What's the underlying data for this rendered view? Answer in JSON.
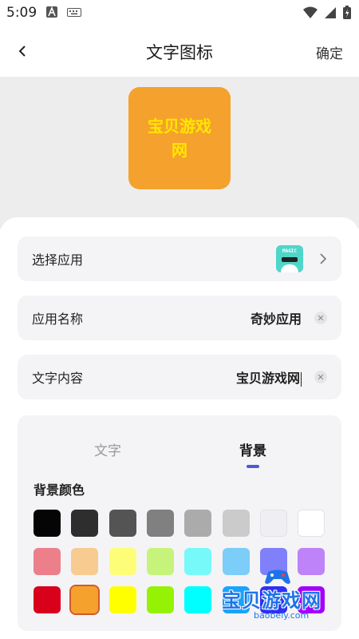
{
  "status_bar": {
    "time": "5:09"
  },
  "app_bar": {
    "title": "文字图标",
    "confirm_label": "确定"
  },
  "preview": {
    "icon_text": "宝贝游戏网",
    "bg_color": "#f5a12d",
    "text_color": "#ffe600"
  },
  "rows": {
    "select_app": {
      "label": "选择应用",
      "app_icon_text": "MAGIC"
    },
    "app_name": {
      "label": "应用名称",
      "value": "奇妙应用"
    },
    "text_content": {
      "label": "文字内容",
      "value": "宝贝游戏网"
    }
  },
  "tabs": {
    "text_label": "文字",
    "background_label": "背景",
    "active": "背景"
  },
  "section": {
    "title": "背景颜色"
  },
  "swatches": [
    [
      "#050505",
      "#2e2e2e",
      "#545454",
      "#808080",
      "#ababab",
      "#cbcbcb",
      "#efeff3",
      "#ffffff"
    ],
    [
      "#ec7f8a",
      "#f8cc91",
      "#fdfd78",
      "#c6f47a",
      "#78f9f9",
      "#7ccdf8",
      "#8080fb",
      "#be82f9"
    ],
    [
      "#d9001c",
      "#f5a12d",
      "#ffff00",
      "#95f204",
      "#00ffff",
      "#1aa3fb",
      "#2f2ff5",
      "#a300fb"
    ]
  ],
  "selected_swatch": "#f5a12d",
  "watermark": {
    "text": "宝贝游戏网",
    "url": "baobeiy.com"
  }
}
